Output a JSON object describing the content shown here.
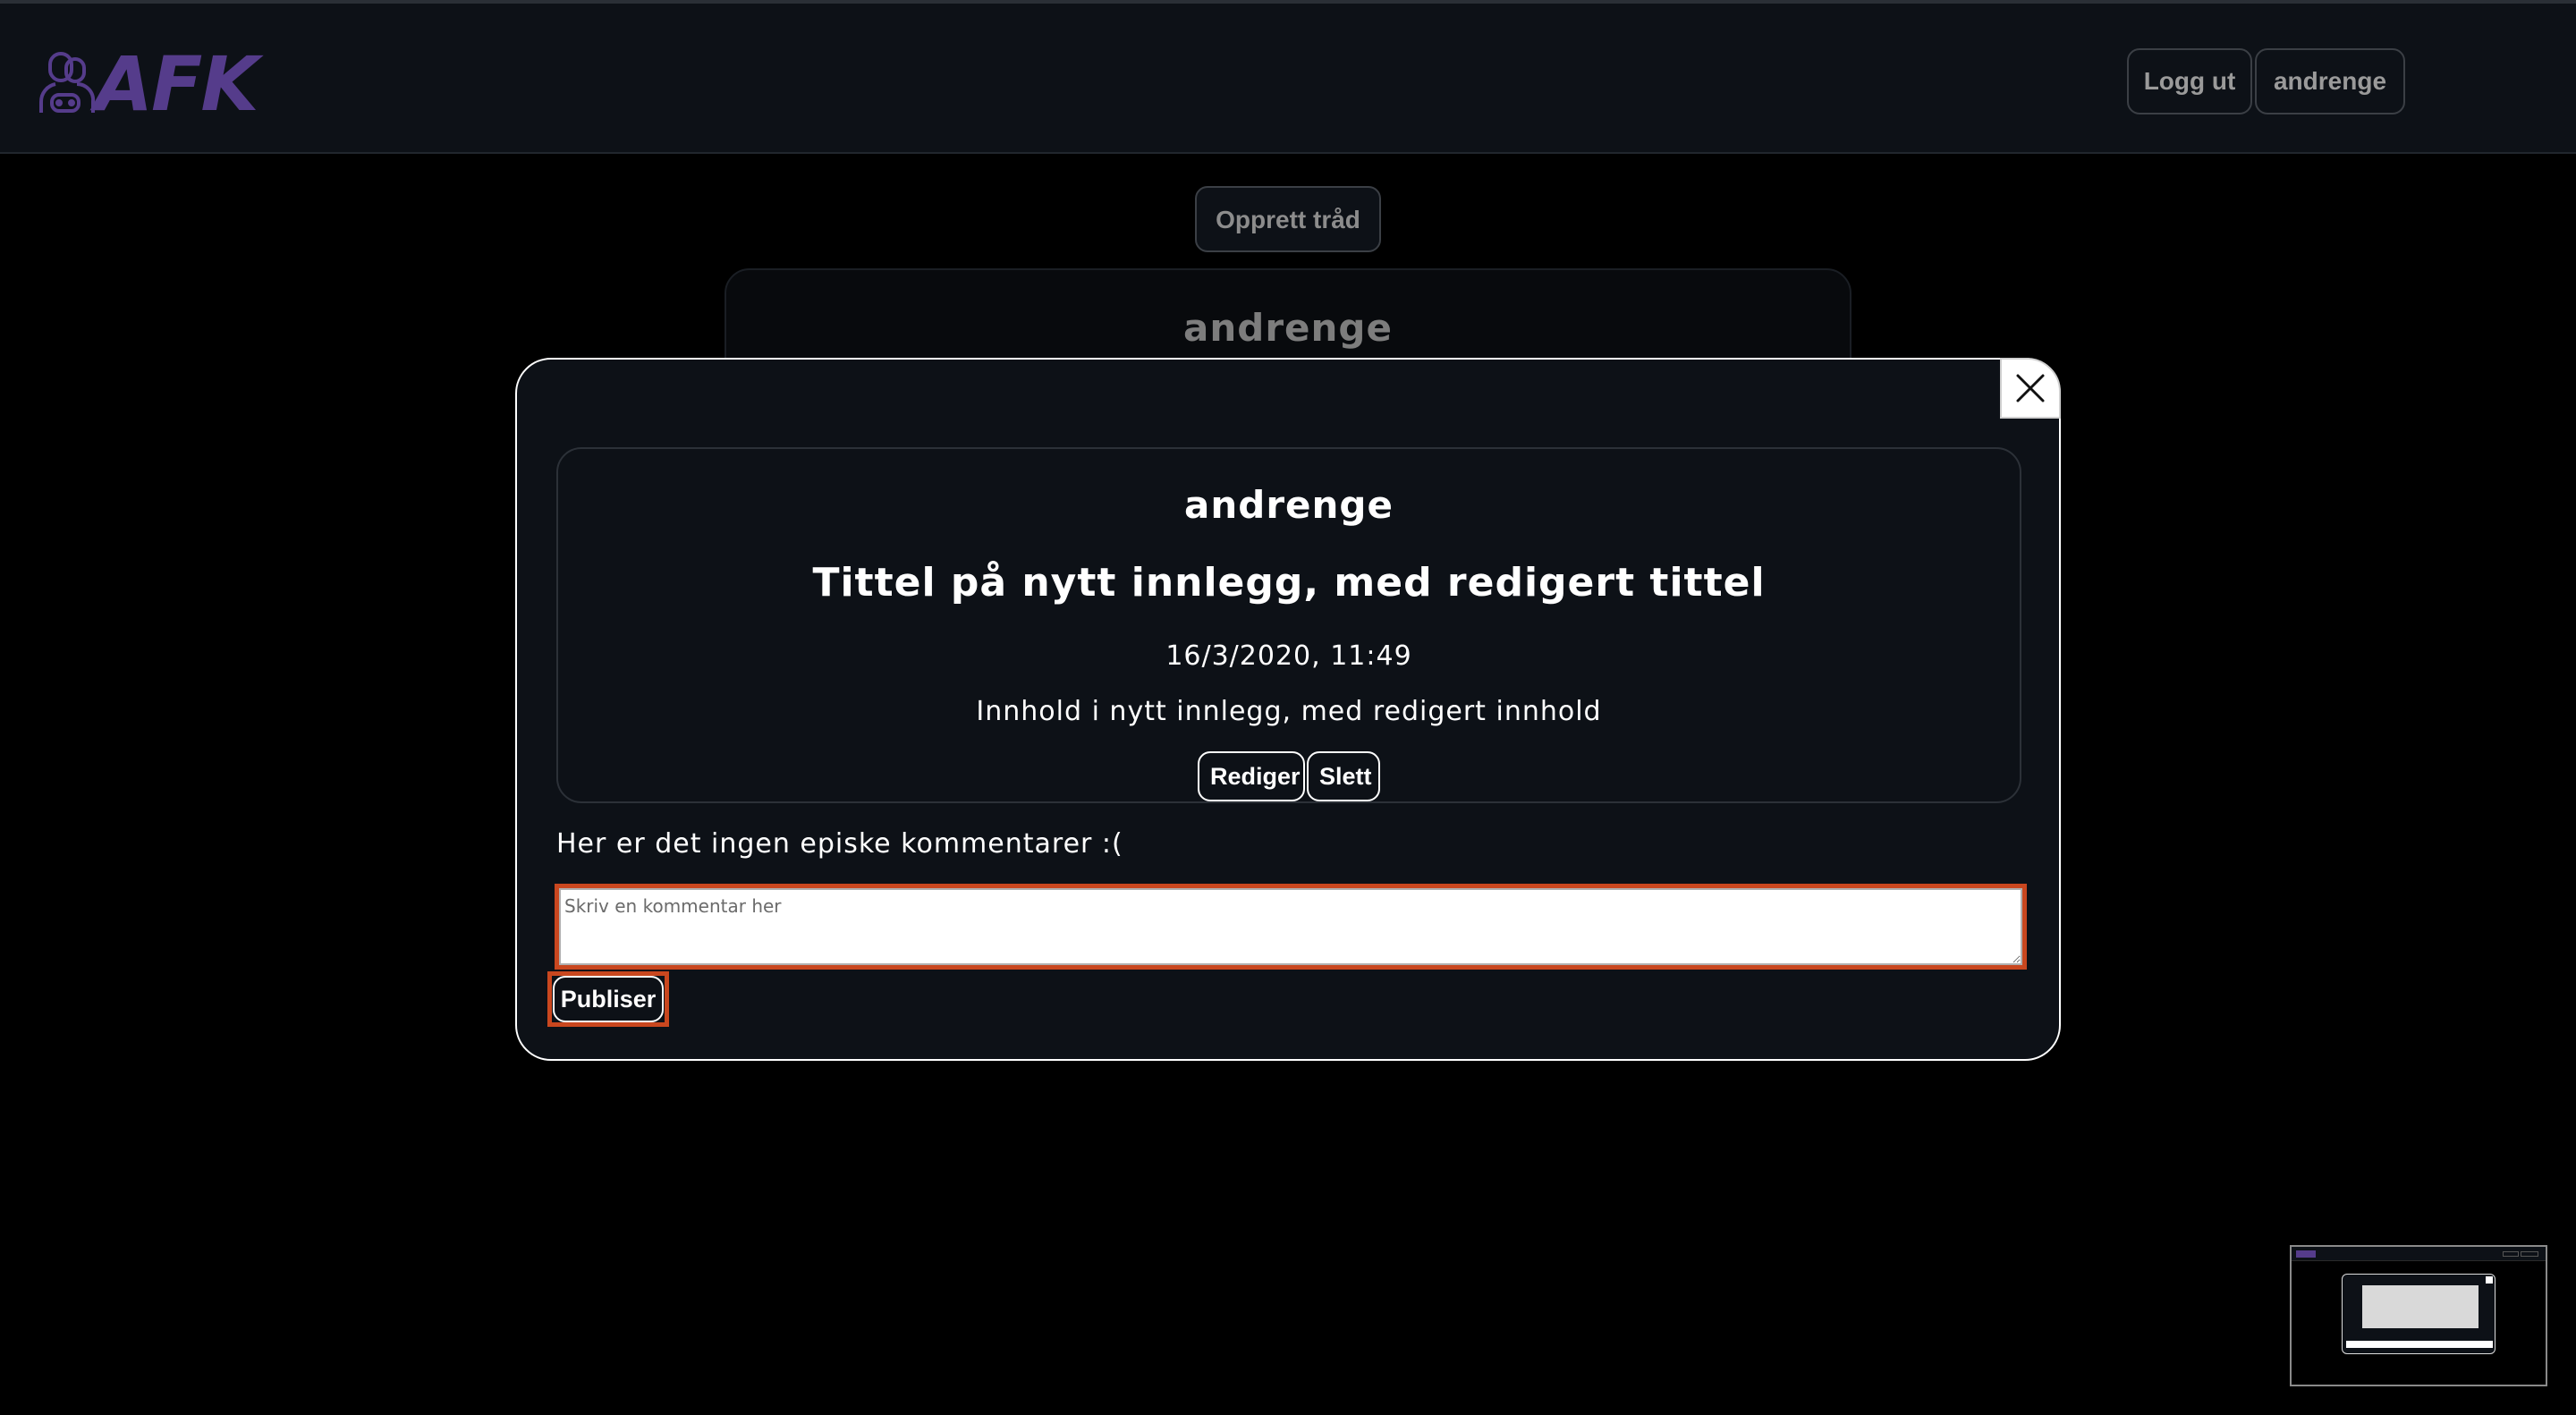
{
  "header": {
    "logo_text": "AFK",
    "logout_label": "Logg ut",
    "user_label": "andrenge"
  },
  "page": {
    "create_thread_label": "Opprett tråd",
    "background_post_author": "andrenge"
  },
  "modal": {
    "post": {
      "author": "andrenge",
      "title": "Tittel på nytt innlegg, med redigert tittel",
      "date": "16/3/2020, 11:49",
      "content": "Innhold i nytt innlegg, med redigert innhold",
      "edit_label": "Rediger",
      "delete_label": "Slett"
    },
    "no_comments_text": "Her er det ingen episke kommentarer :(",
    "comment_placeholder": "Skriv en kommentar her",
    "comment_value": "",
    "publish_label": "Publiser"
  },
  "icons": {
    "logo": "gamers-logo-icon",
    "close": "close-icon"
  },
  "colors": {
    "brand": "#553c8b",
    "highlight": "#c9471f",
    "surface": "#0d1117",
    "background": "#000000"
  }
}
